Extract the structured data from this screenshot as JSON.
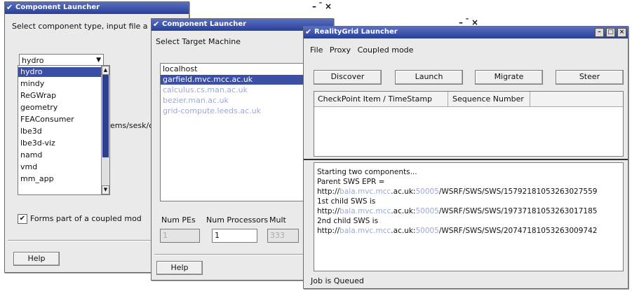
{
  "window1": {
    "title": "Component Launcher",
    "prompt": "Select component type, input file a",
    "combo_value": "hydro",
    "list_items": [
      "hydro",
      "mindy",
      "ReGWrap",
      "geometry",
      "FEAConsumer",
      "lbe3d",
      "lbe3d-viz",
      "namd",
      "vmd",
      "mm_app"
    ],
    "partial_path": "ems/sesk/o",
    "checkbox_label": "Forms part of a coupled mod",
    "help_label": "Help"
  },
  "window2": {
    "title": "Component Launcher",
    "prompt": "Select Target Machine",
    "machines": [
      "localhost",
      "garfield.mvc.mcc.ac.uk",
      "calculus.cs.man.ac.uk",
      "bezier.man.ac.uk",
      "grid-compute.leeds.ac.uk"
    ],
    "col_num_pes": "Num PEs",
    "col_num_processors": "Num Processors",
    "col_third": "Mult",
    "pes_value": "1",
    "processors_value": "1",
    "third_value": "333",
    "help_label": "Help"
  },
  "window3": {
    "title": "RealityGrid Launcher",
    "menu": {
      "file": "File",
      "proxy": "Proxy",
      "coupled": "Coupled mode"
    },
    "buttons": {
      "discover": "Discover",
      "launch": "Launch",
      "migrate": "Migrate",
      "steer": "Steer"
    },
    "table_headers": [
      "CheckPoint Item / TimeStamp",
      "Sequence Number"
    ],
    "log": [
      {
        "t": "Starting two components..."
      },
      {
        "t": "Parent SWS EPR ="
      },
      {
        "pre": "http://",
        "host": "bala.mvc.mcc",
        "mid": ".ac.uk:",
        "port": "50005",
        "post": "/WSRF/SWS/SWS/15792181053263027559"
      },
      {
        "t": "1st child SWS is"
      },
      {
        "pre": "http://",
        "host": "bala.mvc.mcc",
        "mid": ".ac.uk:",
        "port": "50005",
        "post": "/WSRF/SWS/SWS/19737181053263017185"
      },
      {
        "t": "2nd child SWS is"
      },
      {
        "pre": "http://",
        "host": "bala.mvc.mcc",
        "mid": ".ac.uk:",
        "port": "50005",
        "post": "/WSRF/SWS/SWS/20747181053263009742"
      }
    ],
    "status": "Job is Queued"
  }
}
